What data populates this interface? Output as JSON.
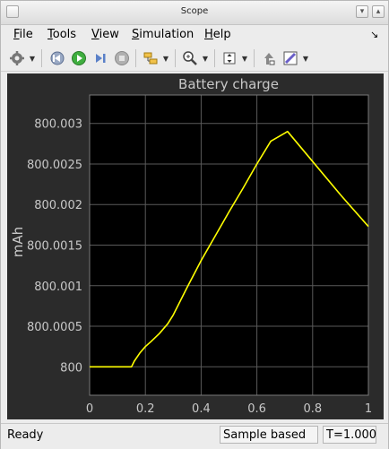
{
  "window": {
    "title": "Scope"
  },
  "menu": [
    {
      "label": "File",
      "u": "F",
      "rest": "ile"
    },
    {
      "label": "Tools",
      "u": "T",
      "rest": "ools"
    },
    {
      "label": "View",
      "u": "V",
      "rest": "iew"
    },
    {
      "label": "Simulation",
      "u": "S",
      "rest": "imulation"
    },
    {
      "label": "Help",
      "u": "H",
      "rest": "elp"
    }
  ],
  "toolbar": {
    "icons": [
      "settings-icon",
      "step-back-icon",
      "run-icon",
      "step-forward-icon",
      "stop-icon",
      "signal-selector-icon",
      "zoom-icon",
      "autoscale-icon",
      "highlight-block-icon",
      "style-icon"
    ]
  },
  "colors": {
    "plot_background": "#000000",
    "figure_background": "#2b2b2b",
    "line": "#ffff00",
    "grid": "#5a5a5a",
    "text": "#c8c8c8"
  },
  "chart_data": {
    "type": "line",
    "title": "Battery charge",
    "xlabel": "",
    "ylabel": "mAh",
    "xlim": [
      0,
      1
    ],
    "ylim": [
      799.99965,
      800.00335
    ],
    "x_ticks": [
      "0",
      "0.2",
      "0.4",
      "0.6",
      "0.8",
      "1"
    ],
    "y_ticks": [
      "800",
      "800.0005",
      "800.001",
      "800.0015",
      "800.002",
      "800.0025",
      "800.003"
    ],
    "grid": true,
    "series": [
      {
        "x": [
          0,
          0.15,
          0.16,
          0.18,
          0.2,
          0.22,
          0.25,
          0.28,
          0.3,
          0.35,
          0.4,
          0.45,
          0.5,
          0.55,
          0.6,
          0.65,
          0.7,
          0.71,
          0.8,
          0.9,
          1.0
        ],
        "y": [
          800.0,
          800.0,
          800.00007,
          800.00017,
          800.00025,
          800.00031,
          800.00041,
          800.00053,
          800.00064,
          800.00098,
          800.00131,
          800.00161,
          800.00191,
          800.0022,
          800.0025,
          800.00278,
          800.00288,
          800.0029,
          800.00253,
          800.00212,
          800.00173
        ]
      }
    ]
  },
  "status": {
    "left": "Ready",
    "mode": "Sample based",
    "time": "T=1.000"
  }
}
